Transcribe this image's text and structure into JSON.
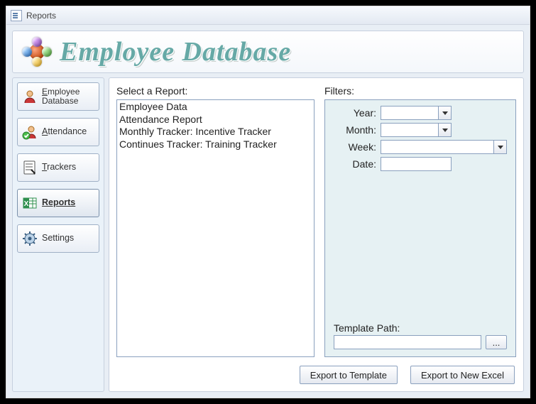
{
  "window": {
    "title": "Reports"
  },
  "header": {
    "app_name": "Employee Database"
  },
  "sidebar": {
    "items": [
      {
        "label": "Employee Database",
        "underline_first": true
      },
      {
        "label": "Attendance",
        "underline_first": true
      },
      {
        "label": "Trackers",
        "underline_first": true
      },
      {
        "label": "Reports",
        "underline_first": false
      },
      {
        "label": "Settings",
        "underline_first": false
      }
    ]
  },
  "report_select": {
    "label": "Select a Report:",
    "items": [
      "Employee Data",
      "Attendance Report",
      "Monthly Tracker: Incentive Tracker",
      "Continues Tracker: Training Tracker"
    ]
  },
  "filters": {
    "label": "Filters:",
    "year": {
      "label": "Year:",
      "value": ""
    },
    "month": {
      "label": "Month:",
      "value": ""
    },
    "week": {
      "label": "Week:",
      "value": ""
    },
    "date": {
      "label": "Date:",
      "value": ""
    },
    "template_path": {
      "label": "Template Path:",
      "value": "",
      "browse": "..."
    }
  },
  "buttons": {
    "export_template": "Export to Template",
    "export_new_excel": "Export to New Excel"
  }
}
